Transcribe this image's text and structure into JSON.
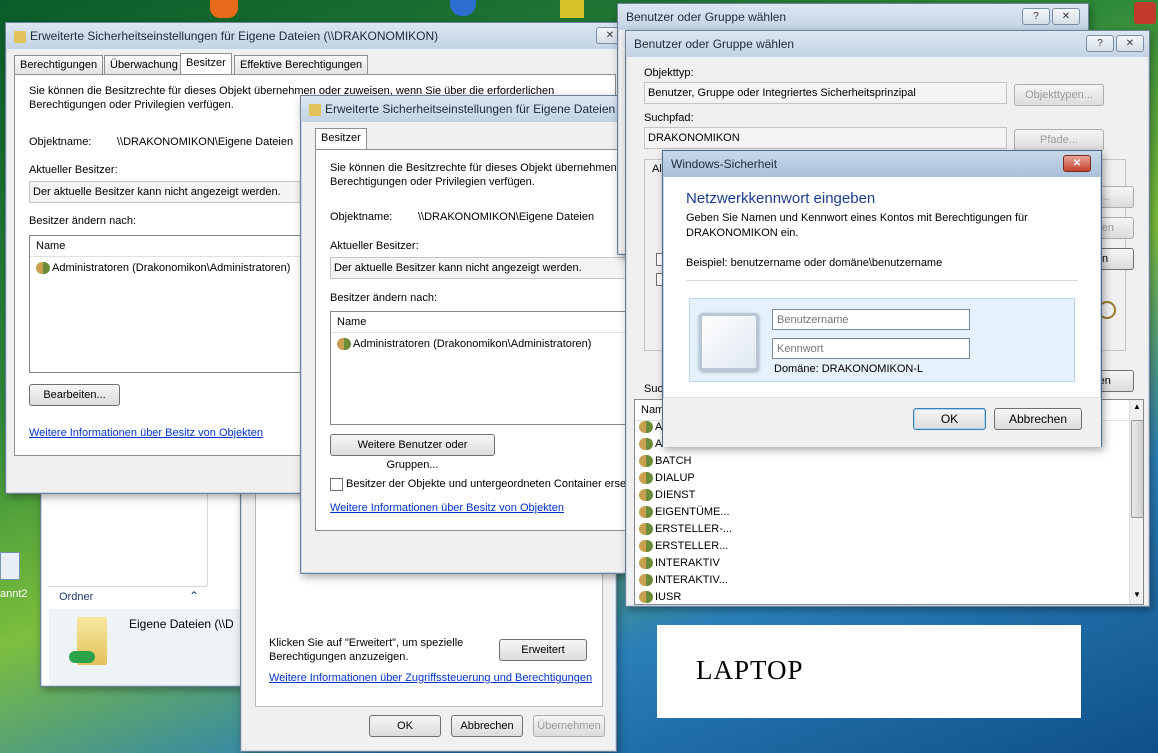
{
  "desktop": {
    "icon_label": "annt2",
    "laptop_label": "LAPTOP"
  },
  "explorer": {
    "folders_header": "Ordner",
    "item_name": "Eigene Dateien (\\\\D"
  },
  "perm_dialog": {
    "hint": "Klicken Sie auf \"Erweitert\", um spezielle Berechtigungen anzuzeigen.",
    "advanced_btn": "Erweitert",
    "link": "Weitere Informationen über Zugriffssteuerung und Berechtigungen",
    "ok": "OK",
    "cancel": "Abbrechen",
    "apply": "Übernehmen"
  },
  "adv1": {
    "title": "Erweiterte Sicherheitseinstellungen für Eigene Dateien (\\\\DRAKONOMIKON)",
    "tabs": [
      "Berechtigungen",
      "Überwachung",
      "Besitzer",
      "Effektive Berechtigungen"
    ],
    "desc": "Sie können die Besitzrechte für dieses Objekt übernehmen oder zuweisen, wenn Sie über die erforderlichen Berechtigungen oder Privilegien verfügen.",
    "desc_line1": "Sie können die Besitzrechte für dieses Objekt übernehmen oder zuweisen, wenn Sie über die erforderlichen",
    "desc_line2": "Berechtigungen oder Privilegien verfügen.",
    "objname_label": "Objektname:",
    "objname_value": "\\\\DRAKONOMIKON\\Eigene Dateien",
    "owner_label": "Aktueller Besitzer:",
    "owner_value": "Der aktuelle Besitzer kann nicht angezeigt werden.",
    "change_label": "Besitzer ändern nach:",
    "col_name": "Name",
    "row1": "Administratoren (Drakonomikon\\Administratoren)",
    "edit_btn": "Bearbeiten...",
    "link": "Weitere Informationen über Besitz von Objekten"
  },
  "adv2": {
    "title": "Erweiterte Sicherheitseinstellungen für Eigene Dateien (",
    "tab": "Besitzer",
    "desc_line1": "Sie können die Besitzrechte für dieses Objekt übernehmen oder",
    "desc_line2": "Berechtigungen oder Privilegien verfügen.",
    "objname_label": "Objektname:",
    "objname_value": "\\\\DRAKONOMIKON\\Eigene Dateien",
    "owner_label": "Aktueller Besitzer:",
    "owner_value": "Der aktuelle Besitzer kann nicht angezeigt werden.",
    "change_label": "Besitzer ändern nach:",
    "col_name": "Name",
    "row1": "Administratoren (Drakonomikon\\Administratoren)",
    "more_btn": "Weitere Benutzer oder Gruppen...",
    "checkbox_label": "Besitzer der Objekte und untergeordneten Container ersetze",
    "link": "Weitere Informationen über Besitz von Objekten"
  },
  "select_back": {
    "title": "Benutzer oder Gruppe wählen"
  },
  "select": {
    "title": "Benutzer oder Gruppe wählen",
    "objtype_label": "Objekttyp:",
    "objtype_value": "Benutzer, Gruppe oder Integriertes Sicherheitsprinzipal",
    "objtype_btn": "Objekttypen...",
    "path_label": "Suchpfad:",
    "path_value": "DRAKONOMIKON",
    "path_btn": "Pfade...",
    "frag_all": "All",
    "frag_en": "en...",
    "frag_nchen": "nchen",
    "frag_den": "den",
    "frag_chen": "chen",
    "frag_such": "Such",
    "col_name": "Nam",
    "results": [
      "A",
      "Authentifiziert...",
      "BATCH",
      "DIALUP",
      "DIENST",
      "EIGENTÜME...",
      "ERSTELLER-...",
      "ERSTELLER...",
      "INTERAKTIV",
      "INTERAKTIV...",
      "IUSR"
    ]
  },
  "security": {
    "title": "Windows-Sicherheit",
    "heading": "Netzwerkkennwort eingeben",
    "desc_line1": "Geben Sie Namen und Kennwort eines Kontos mit Berechtigungen für",
    "desc_line2": "DRAKONOMIKON ein.",
    "example": "Beispiel: benutzername oder domäne\\benutzername",
    "user_placeholder": "Benutzername",
    "pass_placeholder": "Kennwort",
    "domain": "Domäne: DRAKONOMIKON-L",
    "ok": "OK",
    "cancel": "Abbrechen"
  },
  "colors": {
    "link": "#0033cc",
    "heading": "#1a3d8f",
    "close_red": "#c2432c"
  }
}
